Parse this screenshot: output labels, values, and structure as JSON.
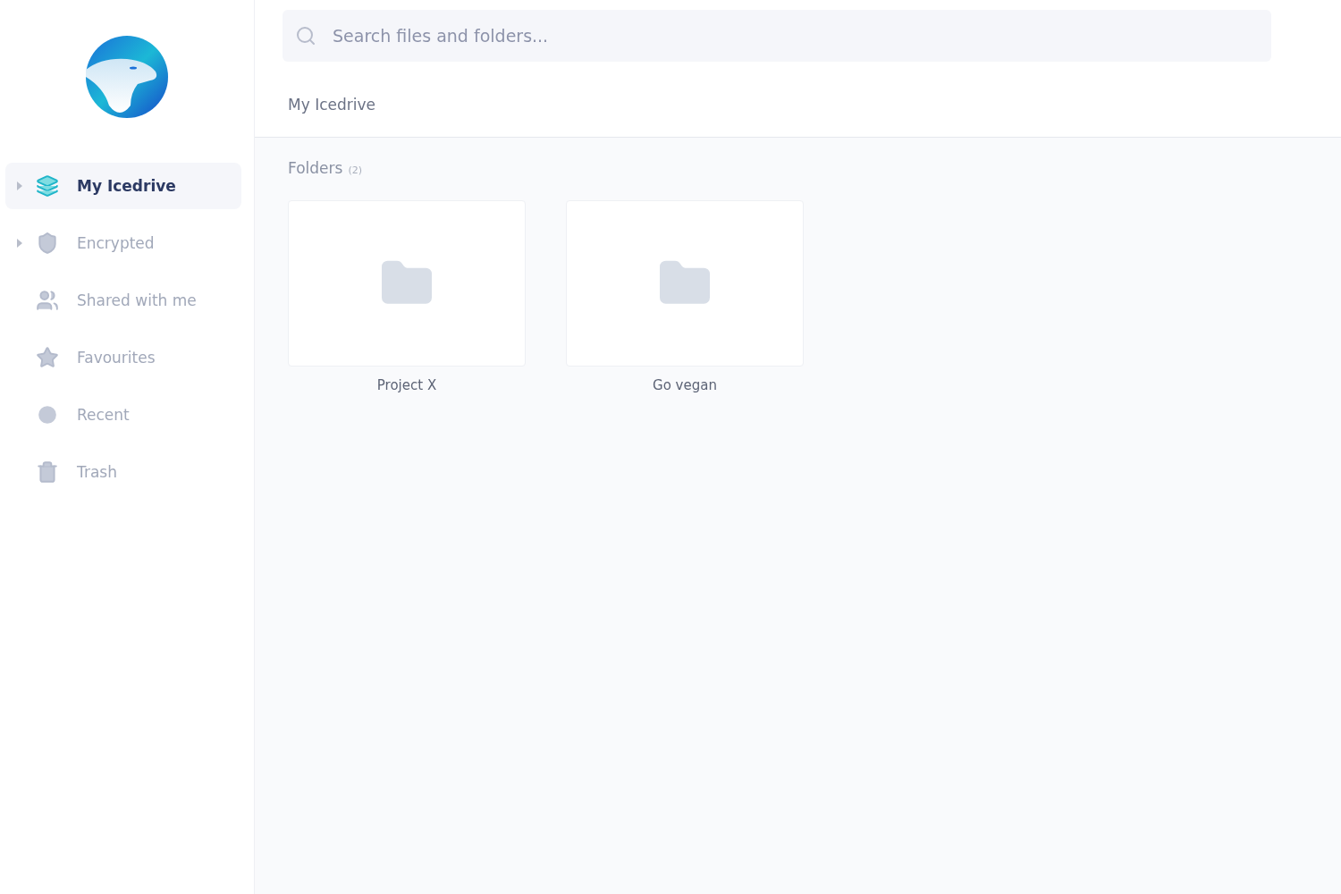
{
  "sidebar": {
    "items": [
      {
        "kind": "drive",
        "label": "My Icedrive",
        "selected": true,
        "expandable": true
      },
      {
        "kind": "encrypted",
        "label": "Encrypted",
        "selected": false,
        "expandable": true
      },
      {
        "kind": "shared",
        "label": "Shared with me",
        "selected": false,
        "expandable": false
      },
      {
        "kind": "favourites",
        "label": "Favourites",
        "selected": false,
        "expandable": false
      },
      {
        "kind": "recent",
        "label": "Recent",
        "selected": false,
        "expandable": false
      },
      {
        "kind": "trash",
        "label": "Trash",
        "selected": false,
        "expandable": false
      }
    ]
  },
  "search": {
    "placeholder": "Search files and folders..."
  },
  "breadcrumb": "My Icedrive",
  "folders": {
    "title": "Folders",
    "count": "(2)",
    "items": [
      {
        "name": "Project X"
      },
      {
        "name": "Go vegan"
      }
    ]
  }
}
